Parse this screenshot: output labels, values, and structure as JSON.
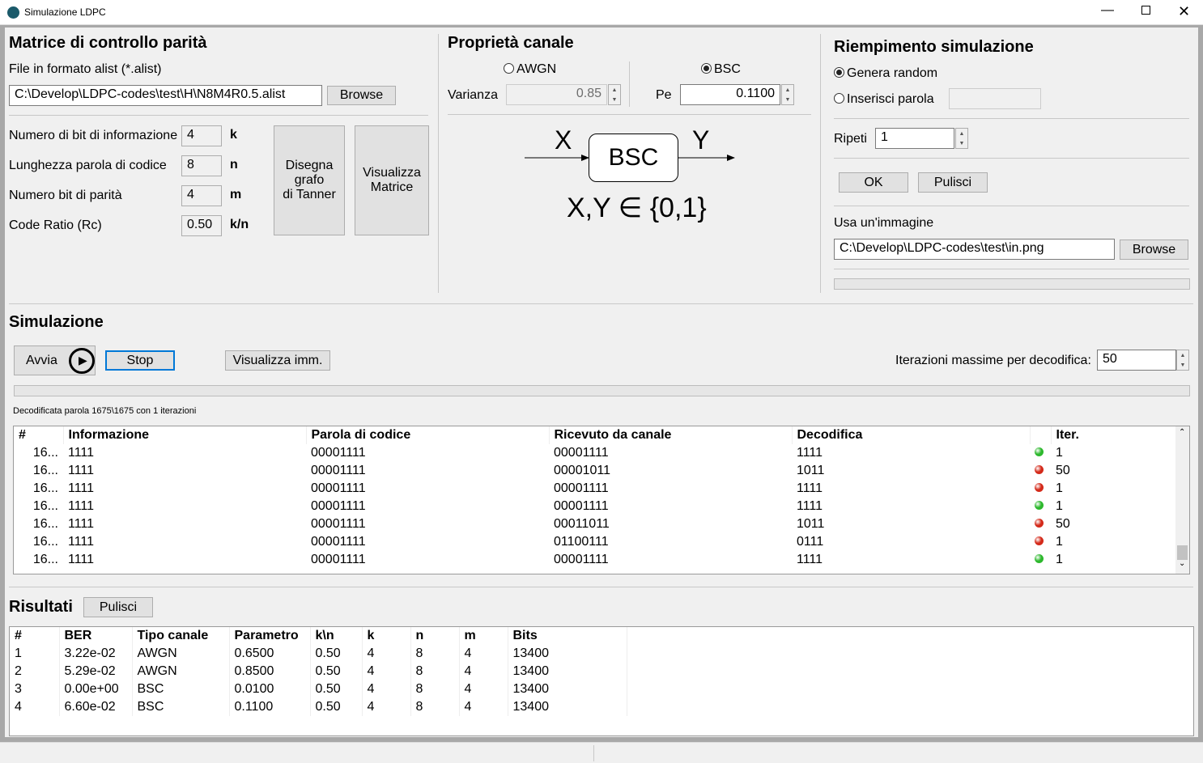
{
  "window": {
    "title": "Simulazione LDPC"
  },
  "matrix": {
    "title": "Matrice di controllo parità",
    "file_label": "File in formato alist (*.alist)",
    "file_path": "C:\\Develop\\LDPC-codes\\test\\H\\N8M4R0.5.alist",
    "browse": "Browse",
    "fields": [
      {
        "label": "Numero di bit di informazione",
        "value": "4",
        "unit": "k"
      },
      {
        "label": "Lunghezza parola di codice",
        "value": "8",
        "unit": "n"
      },
      {
        "label": "Numero bit di parità",
        "value": "4",
        "unit": "m"
      },
      {
        "label": "Code Ratio (Rc)",
        "value": "0.50",
        "unit": "k/n"
      }
    ],
    "tanner_btn": [
      "Disegna",
      "grafo",
      "di Tanner"
    ],
    "matrix_btn": [
      "Visualizza",
      "Matrice"
    ]
  },
  "channel": {
    "title": "Proprietà canale",
    "awgn": "AWGN",
    "bsc": "BSC",
    "selected": "BSC",
    "variance_label": "Varianza",
    "variance": "0.85",
    "pe_label": "Pe",
    "pe": "0.1100",
    "diagram": {
      "x": "X",
      "y": "Y",
      "box": "BSC",
      "formula": "X,Y ∈ {0,1}"
    }
  },
  "fill": {
    "title": "Riempimento simulazione",
    "random": "Genera random",
    "insert": "Inserisci parola",
    "selected": "random",
    "insert_value": "",
    "repeat_label": "Ripeti",
    "repeat": "1",
    "ok": "OK",
    "clear": "Pulisci",
    "image_label": "Usa un'immagine",
    "image_path": "C:\\Develop\\LDPC-codes\\test\\in.png",
    "browse": "Browse",
    "progress": 0
  },
  "simulation": {
    "title": "Simulazione",
    "start": "Avvia",
    "stop": "Stop",
    "view_image": "Visualizza imm.",
    "max_iter_label": "Iterazioni massime per decodifica:",
    "max_iter": "50",
    "progress": 0,
    "status": "Decodificata parola 1675\\1675 con 1 iterazioni",
    "columns": [
      "#",
      "Informazione",
      "Parola di codice",
      "Ricevuto da canale",
      "Decodifica",
      "",
      "Iter."
    ],
    "rows": [
      {
        "n": "16...",
        "info": "1111",
        "code": "00001111",
        "recv": "00001111",
        "dec": "1111",
        "ok": true,
        "iter": "1"
      },
      {
        "n": "16...",
        "info": "1111",
        "code": "00001111",
        "recv": "00001011",
        "dec": "1011",
        "ok": false,
        "iter": "50"
      },
      {
        "n": "16...",
        "info": "1111",
        "code": "00001111",
        "recv": "00001111",
        "dec": "1111",
        "ok": false,
        "iter": "1"
      },
      {
        "n": "16...",
        "info": "1111",
        "code": "00001111",
        "recv": "00001111",
        "dec": "1111",
        "ok": true,
        "iter": "1"
      },
      {
        "n": "16...",
        "info": "1111",
        "code": "00001111",
        "recv": "00011011",
        "dec": "1011",
        "ok": false,
        "iter": "50"
      },
      {
        "n": "16...",
        "info": "1111",
        "code": "00001111",
        "recv": "01100111",
        "dec": "0111",
        "ok": false,
        "iter": "1"
      },
      {
        "n": "16...",
        "info": "1111",
        "code": "00001111",
        "recv": "00001111",
        "dec": "1111",
        "ok": true,
        "iter": "1"
      }
    ]
  },
  "results": {
    "title": "Risultati",
    "clear": "Pulisci",
    "columns": [
      "#",
      "BER",
      "Tipo canale",
      "Parametro",
      "k\\n",
      "k",
      "n",
      "m",
      "Bits"
    ],
    "rows": [
      [
        "1",
        "3.22e-02",
        "AWGN",
        "0.6500",
        "0.50",
        "4",
        "8",
        "4",
        "13400"
      ],
      [
        "2",
        "5.29e-02",
        "AWGN",
        "0.8500",
        "0.50",
        "4",
        "8",
        "4",
        "13400"
      ],
      [
        "3",
        "0.00e+00",
        "BSC",
        "0.0100",
        "0.50",
        "4",
        "8",
        "4",
        "13400"
      ],
      [
        "4",
        "6.60e-02",
        "BSC",
        "0.1100",
        "0.50",
        "4",
        "8",
        "4",
        "13400"
      ]
    ]
  },
  "colors": {
    "ok": "#2db82d",
    "err": "#d42a1a"
  }
}
